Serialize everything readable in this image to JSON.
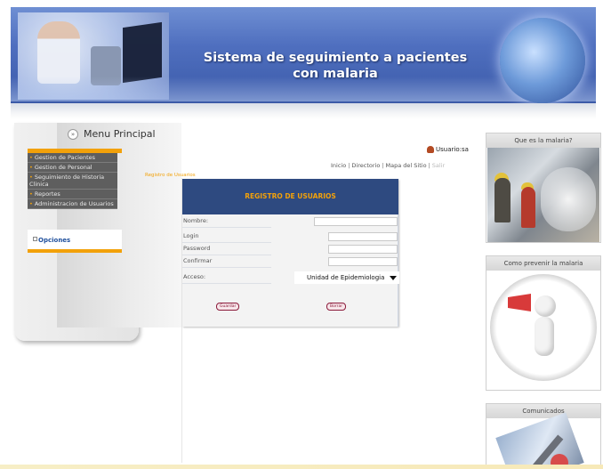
{
  "header": {
    "title_line1": "Sistema de seguimiento a pacientes",
    "title_line2": "con malaria"
  },
  "menu": {
    "title": "Menu Principal",
    "title_icon": "double-chevron-icon",
    "items": [
      {
        "label": "Gestion de Pacientes"
      },
      {
        "label": "Gestion de Personal"
      },
      {
        "label": "Seguimiento de Historia Clinica"
      },
      {
        "label": "Reportes"
      },
      {
        "label": "Administracion de Usuarios"
      }
    ],
    "submenu_label": "Opciones"
  },
  "user": {
    "label": "Usuario:sa",
    "icon": "user-icon"
  },
  "toplinks": {
    "inicio": "Inicio",
    "directorio": "Directorio",
    "mapa": "Mapa del Sitio",
    "salir": "Salir"
  },
  "breadcrumb": "Registro de Usuarios",
  "form": {
    "title": "REGISTRO DE USUARIOS",
    "labels": {
      "nombre": "Nombre:",
      "login": "Login",
      "password": "Password",
      "confirmar": "Confirmar",
      "acceso": "Acceso:"
    },
    "values": {
      "nombre": "",
      "login": "",
      "password": "",
      "confirmar": ""
    },
    "acceso_selected": "Unidad de Epidemiologia",
    "buttons": {
      "guardar": "Guardar",
      "borrar": "Borrar"
    }
  },
  "sidebar": {
    "box1_title": "Que es la malaria?",
    "box2_title": "Como prevenir la malaria",
    "box3_title": "Comunicados"
  },
  "colors": {
    "accent": "#f2a10a",
    "form_header": "#2e4a80",
    "button_border": "#8b1a3a"
  }
}
